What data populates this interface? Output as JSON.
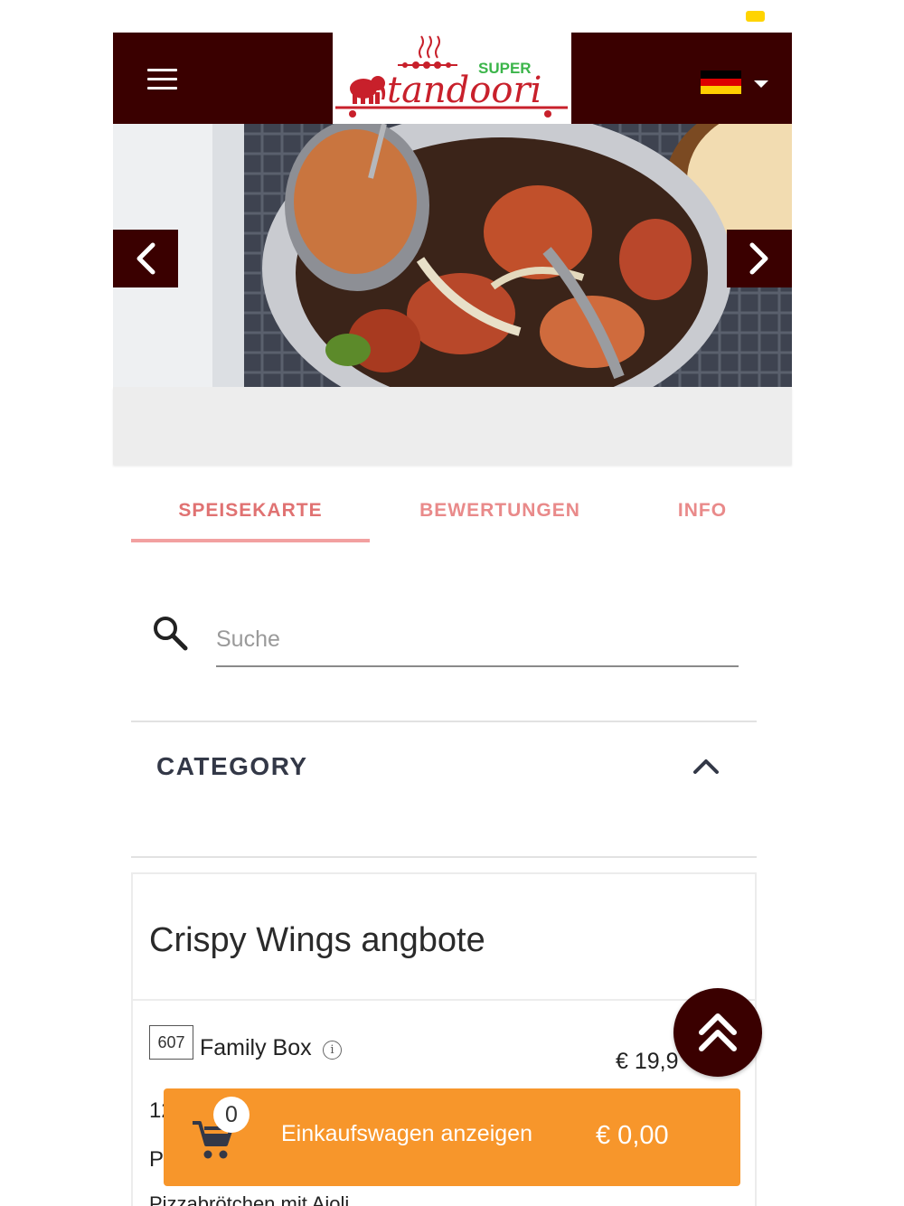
{
  "header": {
    "logo_super": "SUPER",
    "logo_name": "tandoori",
    "language_flag": "de-flag-icon"
  },
  "tabs": [
    {
      "label": "SPEISEKARTE",
      "active": true
    },
    {
      "label": "BEWERTUNGEN",
      "active": false
    },
    {
      "label": "INFO",
      "active": false
    }
  ],
  "search": {
    "placeholder": "Suche",
    "value": ""
  },
  "category": {
    "label": "CATEGORY",
    "expanded": true
  },
  "section": {
    "title": "Crispy Wings angbote",
    "items": [
      {
        "number": "607",
        "name": "Family Box",
        "price": "€ 19,9",
        "desc_line1": "12",
        "desc_line2": "P",
        "desc_line3": "Pizzabrötchen mit Aioli"
      }
    ]
  },
  "cart": {
    "count": "0",
    "label": "Einkaufswagen anzeigen",
    "total": "€ 0,00"
  },
  "colors": {
    "header_bg": "#3a0000",
    "tab_text": "#e98a8a",
    "cart_bg": "#f7962b",
    "status_indicator": "#ffd400"
  }
}
